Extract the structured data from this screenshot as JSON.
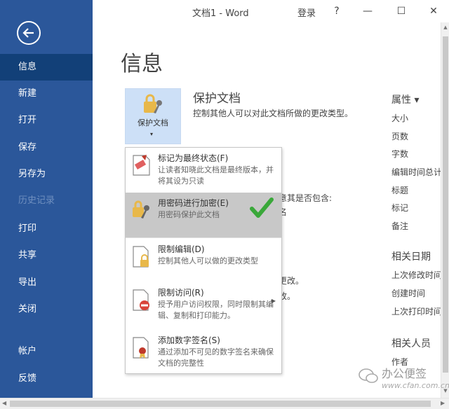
{
  "window": {
    "title": "文档1 - Word",
    "login": "登录",
    "help": "?",
    "minimize": "—",
    "restore": "☐",
    "close": "✕"
  },
  "nav": {
    "back_icon": "back-arrow-icon",
    "items": [
      {
        "label": "信息",
        "active": true
      },
      {
        "label": "新建"
      },
      {
        "label": "打开"
      },
      {
        "label": "保存"
      },
      {
        "label": "另存为"
      },
      {
        "label": "历史记录",
        "disabled": true
      },
      {
        "label": "打印"
      },
      {
        "label": "共享"
      },
      {
        "label": "导出"
      },
      {
        "label": "关闭"
      },
      {
        "label": "帐户"
      },
      {
        "label": "反馈"
      }
    ]
  },
  "main": {
    "page_title": "信息",
    "protect_button": {
      "label": "保护文档",
      "caret": "▾",
      "icon": "lock-key-icon"
    },
    "protect_section": {
      "title": "保护文档",
      "desc": "控制其他人可以对此文档所做的更改类型。"
    },
    "peek_texts": [
      "意其是否包含:",
      "名",
      "更改。",
      "改。"
    ],
    "properties": {
      "title": "属性 ▾",
      "items": [
        "大小",
        "页数",
        "字数",
        "编辑时间总计",
        "标题",
        "标记",
        "备注"
      ]
    },
    "related_dates": {
      "title": "相关日期",
      "items": [
        "上次修改时间",
        "创建时间",
        "上次打印时间"
      ]
    },
    "related_people": {
      "title": "相关人员",
      "items": [
        "作者"
      ]
    }
  },
  "dropdown": {
    "items": [
      {
        "title": "标记为最终状态(F)",
        "desc": "让读者知晓此文档是最终版本，并将其设为只读",
        "icon": "mark-final-icon"
      },
      {
        "title": "用密码进行加密(E)",
        "desc": "用密码保护此文档",
        "icon": "lock-key-icon",
        "highlighted": true
      },
      {
        "title": "限制编辑(D)",
        "desc": "控制其他人可以做的更改类型",
        "icon": "restrict-editing-icon"
      },
      {
        "title": "限制访问(R)",
        "desc": "授予用户访问权限，同时限制其编辑、复制和打印能力。",
        "icon": "restrict-access-icon",
        "has_submenu": true
      },
      {
        "title": "添加数字签名(S)",
        "desc": "通过添加不可见的数字签名来确保文档的完整性",
        "icon": "digital-signature-icon"
      }
    ]
  },
  "annotation": {
    "checkmark_icon": "green-checkmark-icon",
    "color": "#3aa83a"
  },
  "watermark": {
    "text": "办公便签",
    "url": "www.cfan.com.cn"
  },
  "colors": {
    "nav_bg": "#2b579a",
    "nav_active": "#124078",
    "menu_highlight": "#c8c8c8",
    "protect_button_bg": "#cde0f7"
  }
}
